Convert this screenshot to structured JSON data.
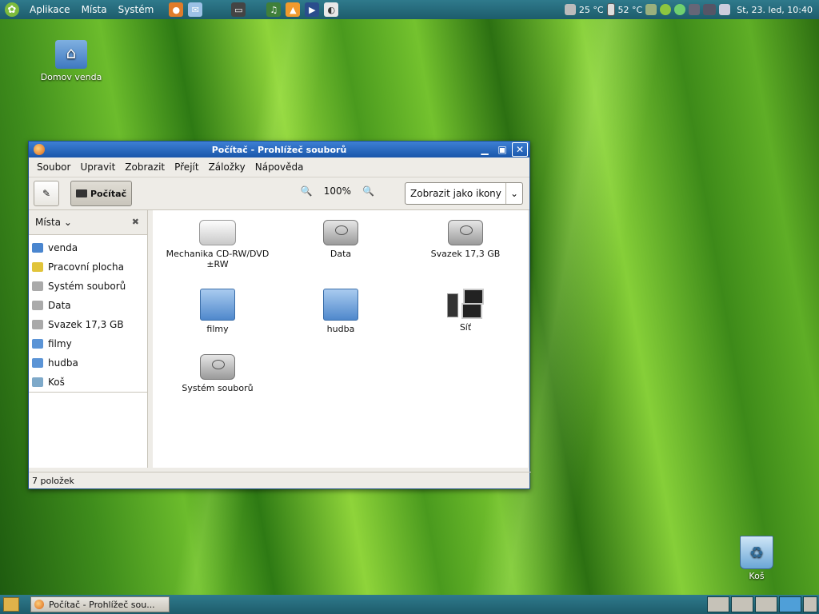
{
  "top_panel": {
    "menus": [
      "Aplikace",
      "Místa",
      "Systém"
    ],
    "temps": [
      "25 °C",
      "52 °C"
    ],
    "clock": "St, 23. led, 10:40"
  },
  "desktop": {
    "home_label": "Domov venda",
    "trash_label": "Koš"
  },
  "window": {
    "title": "Počítač - Prohlížeč souborů",
    "menubar": [
      "Soubor",
      "Upravit",
      "Zobrazit",
      "Přejít",
      "Záložky",
      "Nápověda"
    ],
    "location_button": "Počítač",
    "zoom": "100%",
    "view_mode": "Zobrazit jako ikony",
    "sidebar_title": "Místa",
    "places": [
      "venda",
      "Pracovní plocha",
      "Systém souborů",
      "Data",
      "Svazek 17,3 GB",
      "filmy",
      "hudba",
      "Koš"
    ],
    "items": [
      {
        "label": "Mechanika CD-RW/DVD ±RW",
        "icon": "cdrom-icon"
      },
      {
        "label": "Data",
        "icon": "hdd-icon"
      },
      {
        "label": "Svazek 17,3 GB",
        "icon": "hdd-icon"
      },
      {
        "label": "filmy",
        "icon": "folder-icon"
      },
      {
        "label": "hudba",
        "icon": "folder-icon"
      },
      {
        "label": "Síť",
        "icon": "network-icon"
      },
      {
        "label": "Systém souborů",
        "icon": "hdd-icon"
      }
    ],
    "status": "7 položek"
  },
  "bottom_panel": {
    "task_label": "Počítač - Prohlížeč sou..."
  }
}
